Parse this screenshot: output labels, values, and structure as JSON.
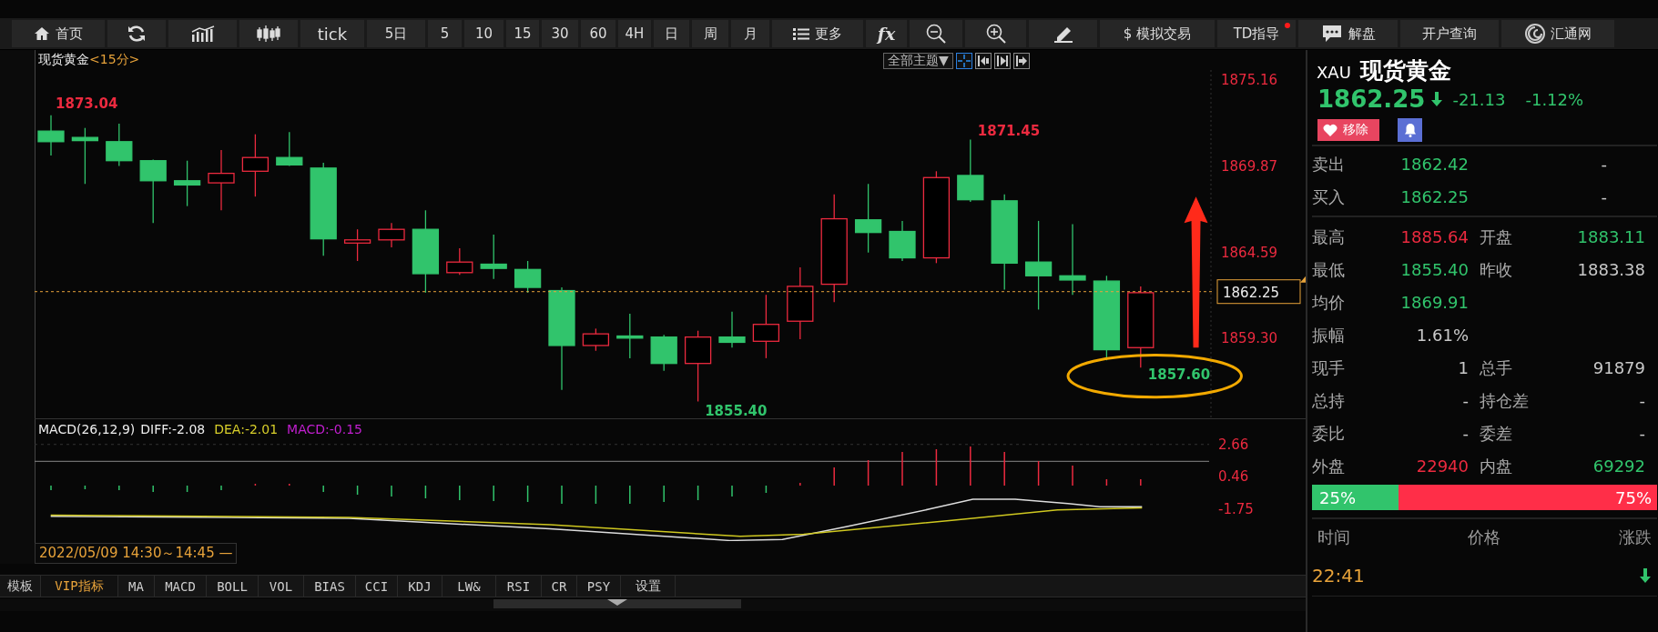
{
  "toolbar": [
    {
      "kind": "icon_text",
      "label": "首页",
      "alert": false
    },
    {
      "kind": "icon",
      "alert": false
    },
    {
      "kind": "icon",
      "alert": false
    },
    {
      "kind": "icon",
      "alert": false
    },
    {
      "kind": "text",
      "label": "tick",
      "alert": false
    },
    {
      "kind": "text",
      "label": "5日",
      "alert": false
    },
    {
      "kind": "text",
      "label": "5",
      "alert": false
    },
    {
      "kind": "text",
      "label": "10",
      "alert": false
    },
    {
      "kind": "text",
      "label": "15",
      "alert": false
    },
    {
      "kind": "text",
      "label": "30",
      "alert": false
    },
    {
      "kind": "text",
      "label": "60",
      "alert": false
    },
    {
      "kind": "text",
      "label": "4H",
      "alert": false
    },
    {
      "kind": "text",
      "label": "日",
      "alert": false
    },
    {
      "kind": "text",
      "label": "周",
      "alert": false
    },
    {
      "kind": "text",
      "label": "月",
      "alert": false
    },
    {
      "kind": "icon_text",
      "label": "更多",
      "alert": false
    },
    {
      "kind": "text",
      "label": "fx",
      "alert": false
    },
    {
      "kind": "icon",
      "alert": false
    },
    {
      "kind": "icon",
      "alert": false
    },
    {
      "kind": "icon",
      "alert": false
    },
    {
      "kind": "text",
      "label": "$ 模拟交易",
      "alert": false
    },
    {
      "kind": "text",
      "label": "TD指导",
      "alert": true
    },
    {
      "kind": "icon_text",
      "label": "解盘",
      "alert": false
    },
    {
      "kind": "text",
      "label": "开户查询",
      "alert": false
    },
    {
      "kind": "icon_text",
      "label": "汇通网",
      "alert": false
    }
  ],
  "chart": {
    "title": "现货黄金",
    "period": "<15分>",
    "theme_menu": "全部主题▼",
    "price_ticks": [
      "1875.16",
      "1869.87",
      "1864.59",
      "1859.30"
    ],
    "current_price": "1862.25",
    "annotations": [
      {
        "text": "1873.04",
        "color": "#ec2a3f"
      },
      {
        "text": "1871.45",
        "color": "#ec2a3f"
      },
      {
        "text": "1855.40",
        "color": "#31c46c"
      },
      {
        "text": "1857.60",
        "color": "#31c46c"
      }
    ]
  },
  "macd": {
    "name": "MACD(26,12,9)",
    "diff": "DIFF:-2.08",
    "dea": "DEA:-2.01",
    "macd": "MACD:-0.15",
    "ticks": [
      "2.66",
      "0.46",
      "-1.75"
    ]
  },
  "time_range": "2022/05/09 14:30～14:45 —",
  "indicator_tabs": [
    {
      "label": "模板",
      "selected": false
    },
    {
      "label": "VIP指标",
      "selected": true
    },
    {
      "label": "MA",
      "selected": false
    },
    {
      "label": "MACD",
      "selected": false
    },
    {
      "label": "BOLL",
      "selected": false
    },
    {
      "label": "VOL",
      "selected": false
    },
    {
      "label": "BIAS",
      "selected": false
    },
    {
      "label": "CCI",
      "selected": false
    },
    {
      "label": "KDJ",
      "selected": false
    },
    {
      "label": "LW&",
      "selected": false
    },
    {
      "label": "RSI",
      "selected": false
    },
    {
      "label": "CR",
      "selected": false
    },
    {
      "label": "PSY",
      "selected": false
    },
    {
      "label": "设置",
      "selected": false
    }
  ],
  "quote": {
    "code": "XAU",
    "name": "现货黄金",
    "price": "1862.25",
    "change": "-21.13",
    "change_percent": "-1.12%",
    "color": "#31c46c",
    "remove_button": "移除"
  },
  "order_book": [
    {
      "label": "卖出",
      "price": "1862.42",
      "volume": "-"
    },
    {
      "label": "买入",
      "price": "1862.25",
      "volume": "-"
    }
  ],
  "stats": [
    [
      {
        "label": "最高",
        "value": "1885.64",
        "color": "#ec2a3f"
      },
      {
        "label": "开盘",
        "value": "1883.11",
        "color": "#31c46c"
      }
    ],
    [
      {
        "label": "最低",
        "value": "1855.40",
        "color": "#31c46c"
      },
      {
        "label": "昨收",
        "value": "1883.38",
        "color": "#c9c9c9"
      }
    ],
    [
      {
        "label": "均价",
        "value": "1869.91",
        "color": "#31c46c"
      }
    ],
    [
      {
        "label": "振幅",
        "value": "1.61%",
        "color": "#c9c9c9"
      }
    ],
    [
      {
        "label": "现手",
        "value": "1",
        "color": "#c9c9c9"
      },
      {
        "label": "总手",
        "value": "91879",
        "color": "#c9c9c9"
      }
    ],
    [
      {
        "label": "总持",
        "value": "-",
        "color": "#c9c9c9"
      },
      {
        "label": "持仓差",
        "value": "-",
        "color": "#c9c9c9"
      }
    ],
    [
      {
        "label": "委比",
        "value": "-",
        "color": "#c9c9c9"
      },
      {
        "label": "委差",
        "value": "-",
        "color": "#c9c9c9"
      }
    ],
    [
      {
        "label": "外盘",
        "value": "22940",
        "color": "#ec2a3f"
      },
      {
        "label": "内盘",
        "value": "69292",
        "color": "#31c46c"
      }
    ]
  ],
  "volume_ratio": {
    "level": 0.25,
    "buy_label": "25%",
    "sell_label": "75%"
  },
  "trades": {
    "columns": [
      "时间",
      "价格",
      "涨跌"
    ],
    "rows": [
      {
        "time": "22:41"
      }
    ]
  }
}
